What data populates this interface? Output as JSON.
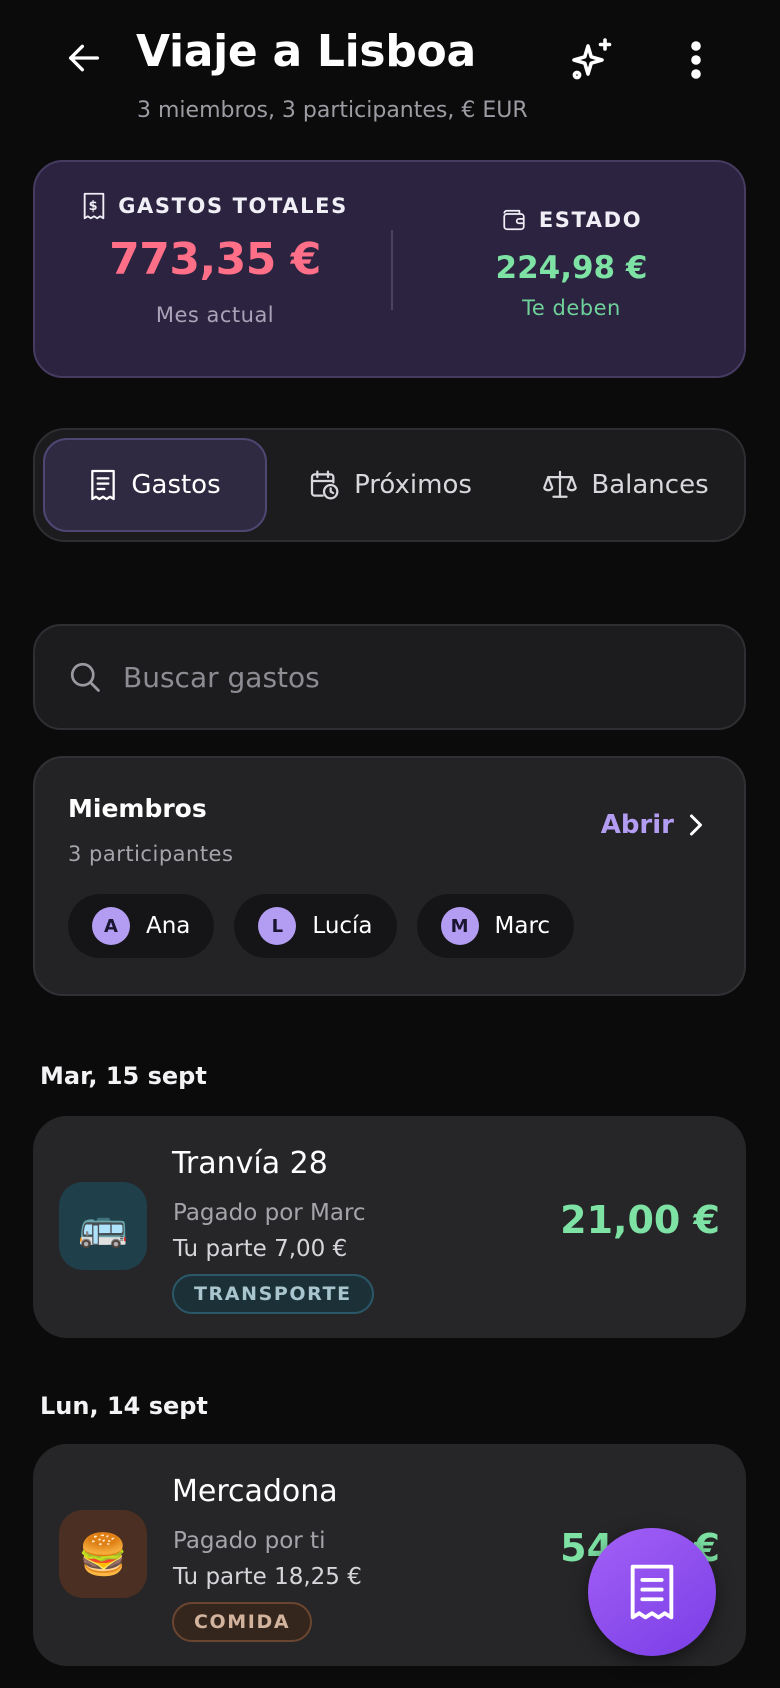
{
  "header": {
    "title": "Viaje a Lisboa",
    "subtitle": "3 miembros, 3 participantes, € EUR"
  },
  "summary": {
    "total_label": "GASTOS TOTALES",
    "total_value": "773,35 €",
    "total_caption": "Mes actual",
    "status_label": "ESTADO",
    "status_value": "224,98 €",
    "status_caption": "Te deben"
  },
  "tabs": [
    {
      "label": "Gastos",
      "icon": "receipt-icon",
      "active": true
    },
    {
      "label": "Próximos",
      "icon": "calendar-clock-icon",
      "active": false
    },
    {
      "label": "Balances",
      "icon": "scale-icon",
      "active": false
    }
  ],
  "search": {
    "placeholder": "Buscar gastos"
  },
  "members": {
    "title": "Miembros",
    "count": "3 participantes",
    "open_label": "Abrir",
    "list": [
      {
        "initial": "A",
        "name": "Ana"
      },
      {
        "initial": "L",
        "name": "Lucía"
      },
      {
        "initial": "M",
        "name": "Marc"
      }
    ]
  },
  "groups": [
    {
      "date": "Mar, 15 sept",
      "expenses": [
        {
          "title": "Tranvía 28",
          "paid_by": "Pagado por Marc",
          "share": "Tu parte 7,00 €",
          "tag": "TRANSPORTE",
          "amount": "21,00 €",
          "emoji": "🚌",
          "icon": "bus-icon"
        }
      ]
    },
    {
      "date": "Lun, 14 sept",
      "expenses": [
        {
          "title": "Mercadona",
          "paid_by": "Pagado por ti",
          "share": "Tu parte 18,25 €",
          "tag": "COMIDA",
          "amount": "54,75 €",
          "emoji": "🍔",
          "icon": "burger-icon"
        }
      ]
    }
  ],
  "colors": {
    "accent": "#b39df2",
    "expense_red": "#ff6f88",
    "positive_green": "#7de2a4",
    "fab_purple": "#8b4ef0"
  }
}
